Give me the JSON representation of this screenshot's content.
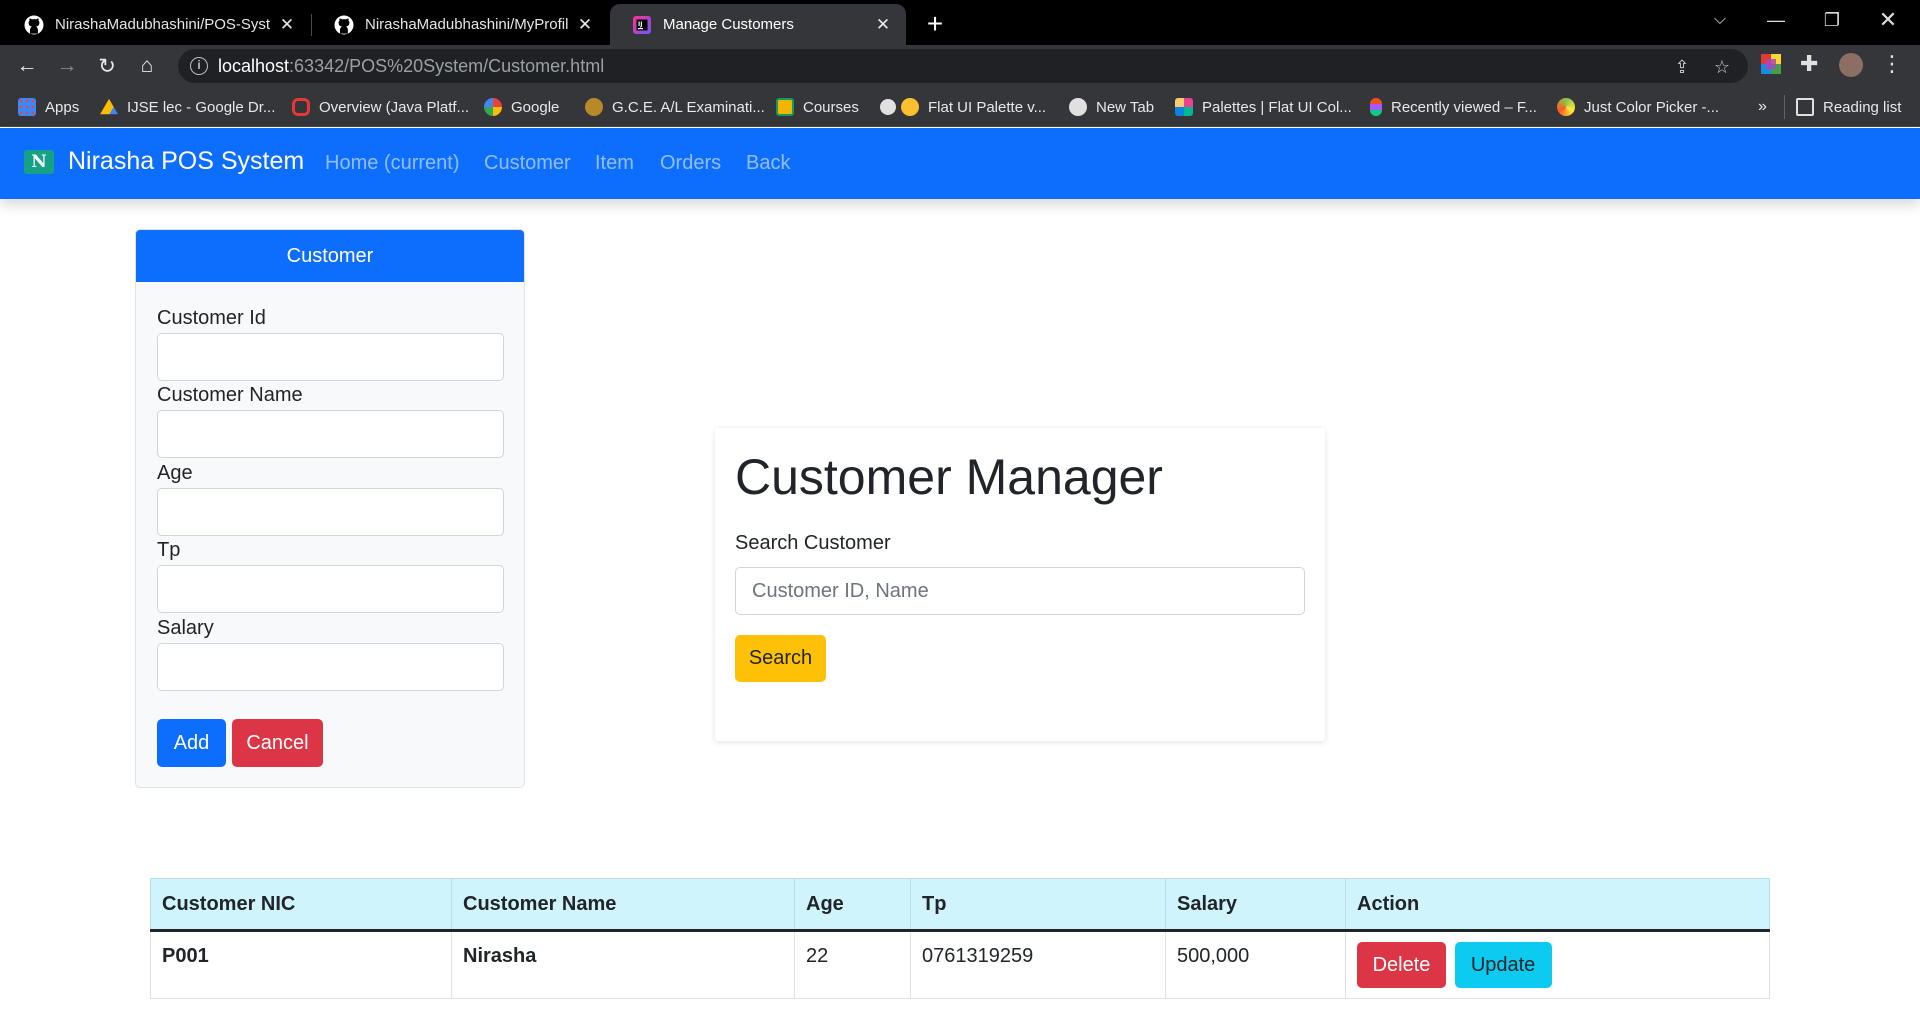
{
  "browser": {
    "tabs": [
      {
        "title": "NirashaMadubhashini/POS-System",
        "icon": "github-icon",
        "active": false
      },
      {
        "title": "NirashaMadubhashini/MyProfile",
        "icon": "github-icon",
        "active": false
      },
      {
        "title": "Manage Customers",
        "icon": "intellij-icon",
        "active": true
      }
    ],
    "url_host": "localhost",
    "url_path": ":63342/POS%20System/Customer.html",
    "bookmarks": [
      {
        "label": "Apps",
        "icon": "apps-grid-icon",
        "color": "#4285f4"
      },
      {
        "label": "IJSE lec - Google Dr...",
        "icon": "google-drive-icon",
        "color": "#fbbc04"
      },
      {
        "label": "Overview (Java Platf...",
        "icon": "oracle-icon",
        "color": "#e53935"
      },
      {
        "label": "Google",
        "icon": "google-icon",
        "color": "#ffffff"
      },
      {
        "label": "G.C.E. A/L Examinati...",
        "icon": "exam-seal-icon",
        "color": "#c9a227"
      },
      {
        "label": "Courses",
        "icon": "classroom-icon",
        "color": "#f4b400"
      },
      {
        "label": "Flat UI Palette v...",
        "icon": "globe-icon",
        "color": "#cccccc"
      },
      {
        "label": "New Tab",
        "icon": "globe-icon",
        "color": "#cccccc"
      },
      {
        "label": "Palettes | Flat UI Col...",
        "icon": "palette-icon",
        "color": "#e84393"
      },
      {
        "label": "Recently viewed – F...",
        "icon": "figma-icon",
        "color": "#f24e1e"
      },
      {
        "label": "Just Color Picker -...",
        "icon": "color-picker-icon",
        "color": "#8bc34a"
      }
    ],
    "bookmarks_overflow": "»",
    "reading_list": "Reading list"
  },
  "navbar": {
    "brand": "Nirasha POS System",
    "brand_logo_letter": "N",
    "links": [
      "Home (current)",
      "Customer",
      "Item",
      "Orders",
      "Back"
    ]
  },
  "form": {
    "header": "Customer",
    "fields": [
      {
        "label": "Customer Id",
        "value": ""
      },
      {
        "label": "Customer Name",
        "value": ""
      },
      {
        "label": "Age",
        "value": ""
      },
      {
        "label": "Tp",
        "value": ""
      },
      {
        "label": "Salary",
        "value": ""
      }
    ],
    "add_label": "Add",
    "cancel_label": "Cancel"
  },
  "manager": {
    "title": "Customer Manager",
    "search_label": "Search Customer",
    "search_placeholder": "Customer ID, Name",
    "search_button": "Search"
  },
  "table": {
    "columns": [
      "Customer NIC",
      "Customer Name",
      "Age",
      "Tp",
      "Salary",
      "Action"
    ],
    "rows": [
      {
        "nic": "P001",
        "name": "Nirasha",
        "age": "22",
        "tp": "0761319259",
        "salary": "500,000",
        "delete_label": "Delete",
        "update_label": "Update"
      }
    ]
  },
  "colors": {
    "primary": "#0d6efd",
    "danger": "#dc3545",
    "warning": "#ffc107",
    "info": "#0dcaf0",
    "table_header": "#cff4fc"
  }
}
